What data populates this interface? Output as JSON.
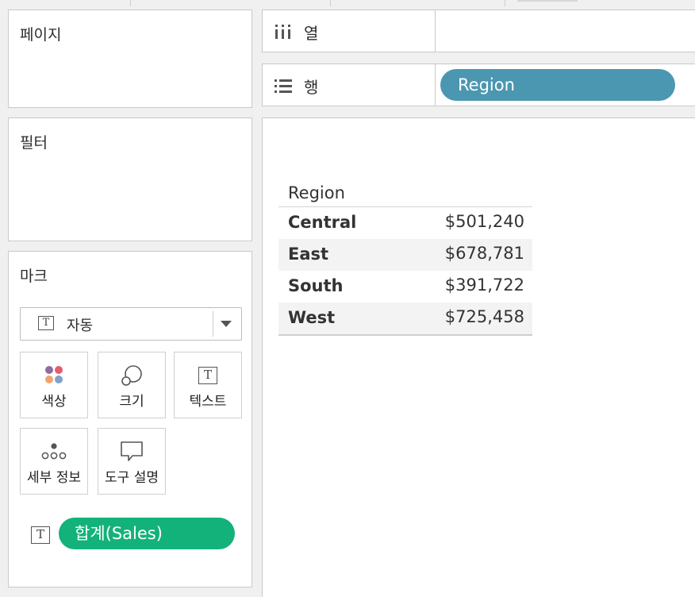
{
  "cards": {
    "pages_title": "페이지",
    "filters_title": "필터",
    "marks_title": "마크"
  },
  "shelves": {
    "columns": {
      "label": "열",
      "icon": "columns-icon"
    },
    "rows": {
      "label": "행",
      "icon": "rows-icon",
      "pill": "Region",
      "pill_color": "#4b97b2"
    }
  },
  "marks": {
    "mark_type": "자동",
    "buttons": {
      "color": "색상",
      "size": "크기",
      "text": "텍스트",
      "detail": "세부 정보",
      "tooltip": "도구 설명"
    },
    "field_pill": "합계(Sales)",
    "field_pill_color": "#13b27b"
  },
  "table": {
    "header": "Region",
    "rows": [
      {
        "region": "Central",
        "value": "$501,240"
      },
      {
        "region": "East",
        "value": "$678,781"
      },
      {
        "region": "South",
        "value": "$391,722"
      },
      {
        "region": "West",
        "value": "$725,458"
      }
    ]
  }
}
